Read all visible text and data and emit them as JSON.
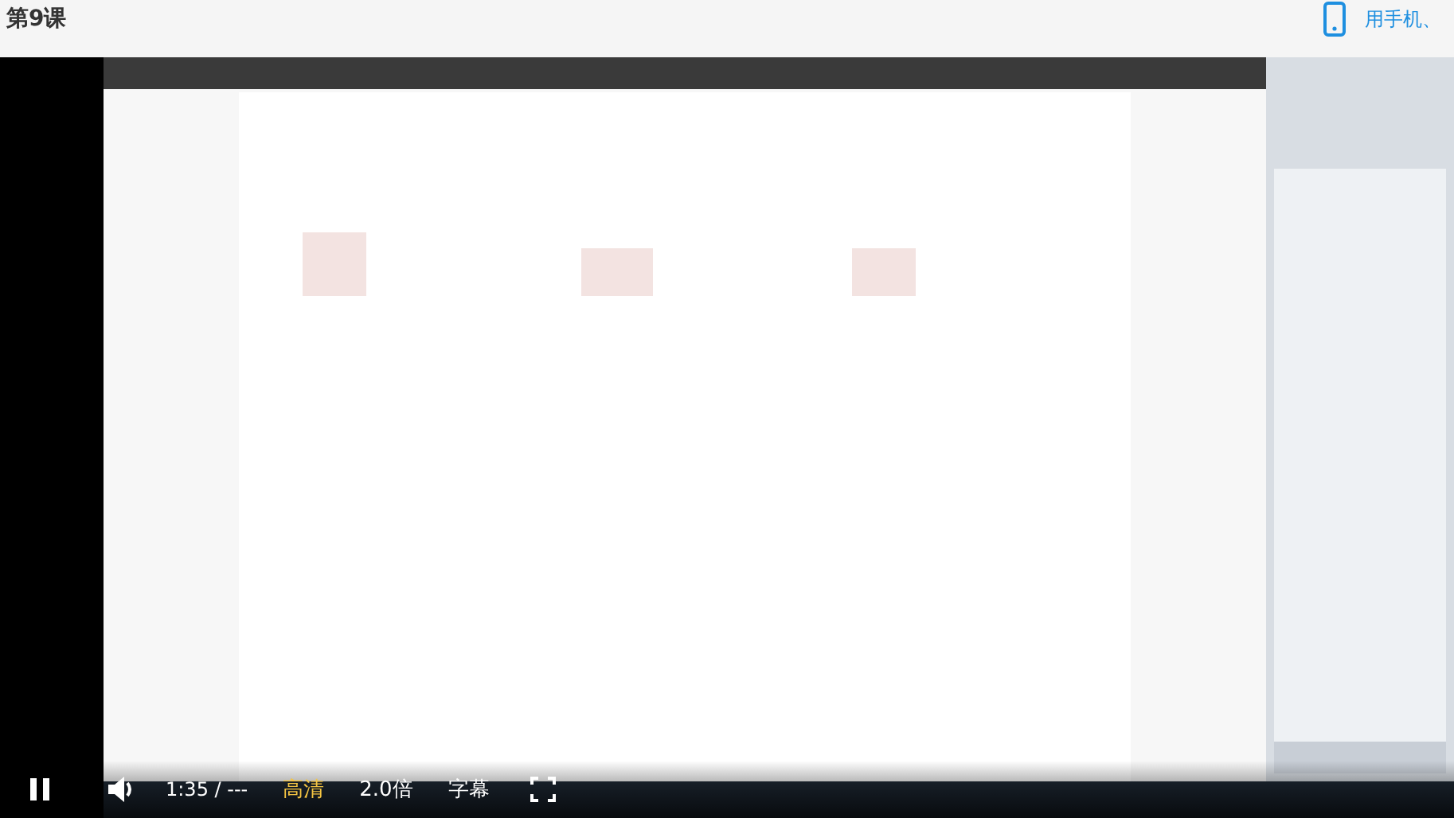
{
  "header": {
    "title": "第9课",
    "mobile_link": "用手机、"
  },
  "player": {
    "playing": true,
    "time": "1:35 / ---",
    "quality": "高清",
    "speed": "2.0倍",
    "subtitles": "字幕"
  }
}
